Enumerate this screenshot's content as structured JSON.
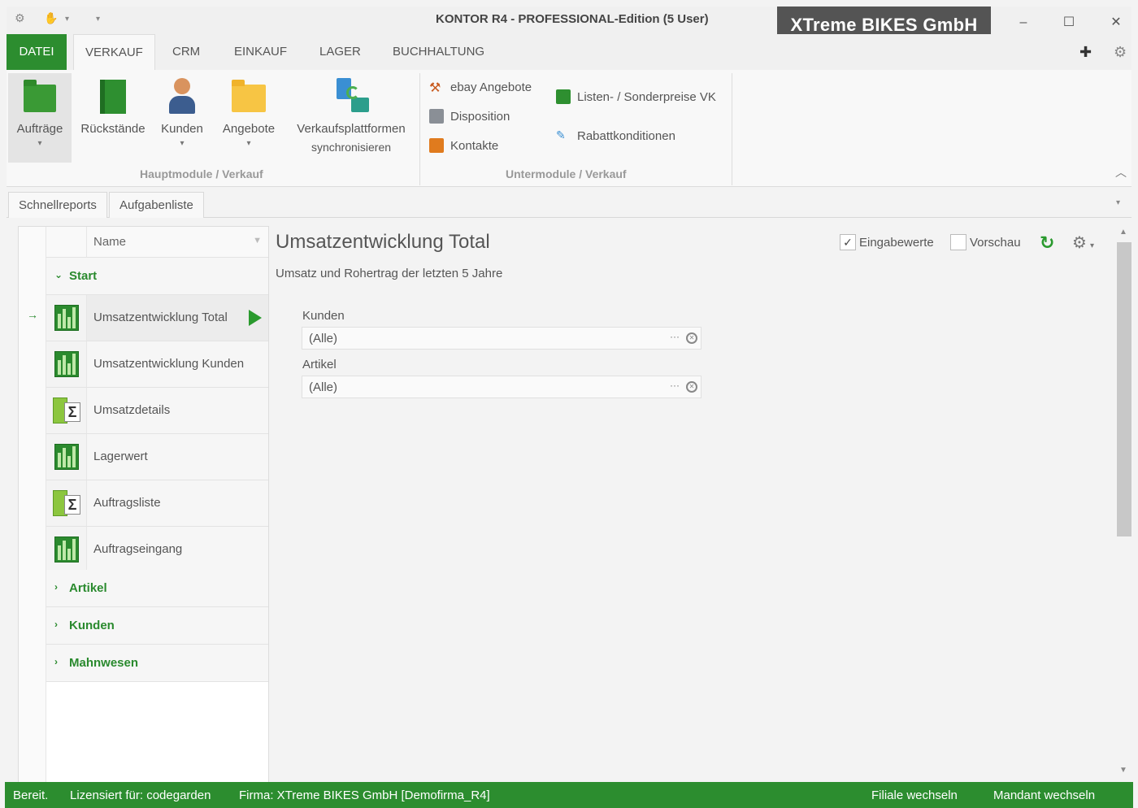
{
  "window": {
    "title": "KONTOR R4 - PROFESSIONAL-Edition (5 User)",
    "company": "XTreme BIKES GmbH",
    "minimize": "–",
    "maximize": "☐",
    "close": "✕"
  },
  "menu": {
    "file": "DATEI",
    "tabs": [
      "VERKAUF",
      "CRM",
      "EINKAUF",
      "LAGER",
      "BUCHHALTUNG"
    ],
    "active_tab": "VERKAUF"
  },
  "ribbon": {
    "main_buttons": [
      {
        "label": "Aufträge",
        "icon": "folder-green-icon",
        "has_dropdown": true
      },
      {
        "label": "Rückstände",
        "icon": "book-green-icon",
        "has_dropdown": false
      },
      {
        "label": "Kunden",
        "icon": "person-icon",
        "has_dropdown": true
      },
      {
        "label": "Angebote",
        "icon": "folder-yellow-icon",
        "has_dropdown": true
      },
      {
        "label": "Verkaufsplattformen",
        "label2": "synchronisieren",
        "icon": "sync-icon",
        "has_dropdown": false
      }
    ],
    "group1_label": "Hauptmodule / Verkauf",
    "sub_buttons_col1": [
      {
        "label": "ebay Angebote",
        "icon": "hammer-icon"
      },
      {
        "label": "Disposition",
        "icon": "calculator-icon"
      },
      {
        "label": "Kontakte",
        "icon": "contacts-book-icon"
      }
    ],
    "sub_buttons_col2": [
      {
        "label": "Listen- / Sonderpreise VK",
        "icon": "price-list-icon"
      },
      {
        "label": "Rabattkonditionen",
        "icon": "discount-icon"
      }
    ],
    "group2_label": "Untermodule / Verkauf"
  },
  "subtabs": [
    "Schnellreports",
    "Aufgabenliste"
  ],
  "reportlist": {
    "header_name": "Name",
    "groups": [
      {
        "label": "Start",
        "expanded": true
      },
      {
        "label": "Artikel",
        "expanded": false
      },
      {
        "label": "Kunden",
        "expanded": false
      },
      {
        "label": "Mahnwesen",
        "expanded": false
      }
    ],
    "items": [
      {
        "label": "Umsatzentwicklung Total",
        "icon": "bar-chart-icon",
        "active": true
      },
      {
        "label": "Umsatzentwicklung Kunden",
        "icon": "bar-chart-icon",
        "active": false
      },
      {
        "label": "Umsatzdetails",
        "icon": "sum-table-icon",
        "active": false
      },
      {
        "label": "Lagerwert",
        "icon": "bar-chart-icon",
        "active": false
      },
      {
        "label": "Auftragsliste",
        "icon": "sum-table-icon",
        "active": false
      },
      {
        "label": "Auftragseingang",
        "icon": "bar-chart-icon",
        "active": false
      }
    ]
  },
  "report": {
    "title": "Umsatzentwicklung Total",
    "subtitle": "Umsatz und Rohertrag der letzten 5 Jahre",
    "options": {
      "input_values_label": "Eingabewerte",
      "input_values_checked": true,
      "preview_label": "Vorschau",
      "preview_checked": false
    },
    "params": [
      {
        "label": "Kunden",
        "value": "(Alle)"
      },
      {
        "label": "Artikel",
        "value": "(Alle)"
      }
    ]
  },
  "status": {
    "ready": "Bereit.",
    "licensed": "Lizensiert für: codegarden",
    "firm": "Firma: XTreme BIKES GmbH [Demofirma_R4]",
    "switch_branch": "Filiale wechseln",
    "switch_client": "Mandant wechseln"
  },
  "colors": {
    "accent_green": "#2c8d2f",
    "company_box": "#545454"
  }
}
